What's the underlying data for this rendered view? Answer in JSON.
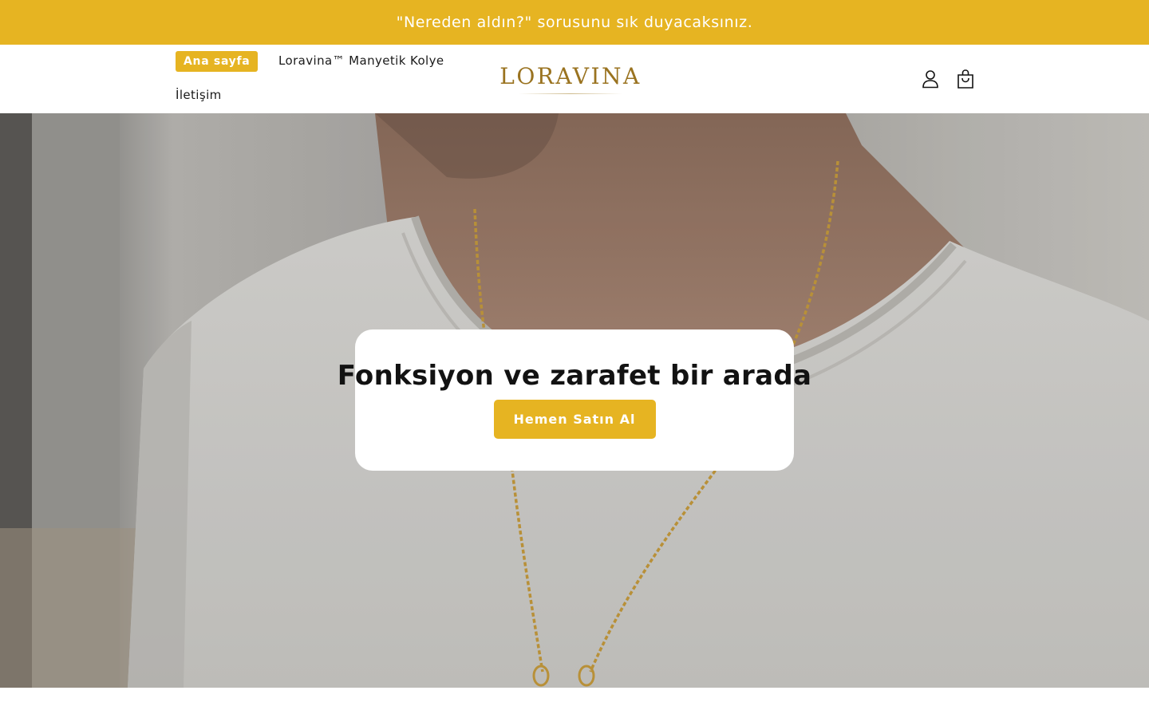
{
  "announcement": {
    "text": "\"Nereden aldın?\" sorusunu sık duyacaksınız."
  },
  "header": {
    "nav": {
      "home_label": "Ana sayfa",
      "necklace_label": "Loravina™ Manyetik Kolye",
      "contact_label": "İletişim"
    },
    "logo_text": "LORAVINA",
    "icons": {
      "account": "account-icon",
      "cart": "cart-icon"
    }
  },
  "hero": {
    "title": "Fonksiyon ve zarafet bir arada",
    "cta_label": "Hemen Satın Al"
  },
  "colors": {
    "accent": "#e6b422",
    "logo": "#9a7320",
    "text": "#121212"
  }
}
